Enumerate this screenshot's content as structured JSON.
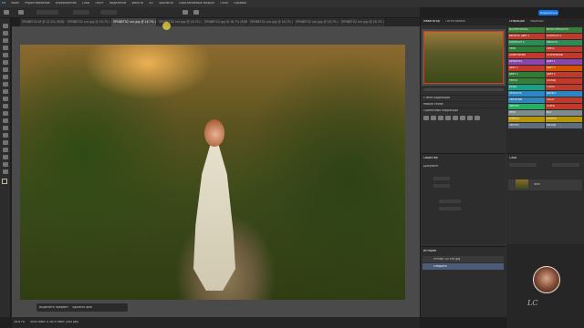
{
  "menu": [
    "Файл",
    "Редактирование",
    "Изображение",
    "Слои",
    "Текст",
    "Выделение",
    "Фильтр",
    "3D",
    "Просмотр",
    "Подключаемые модули",
    "Окно",
    "Справка"
  ],
  "options": {
    "share_label": "Поделиться"
  },
  "tabs": [
    {
      "label": "ПРИВЕТ02.tif @ 12.5% (RGB/8)"
    },
    {
      "label": "ПРИВЕТ02 сат.jpg @ 16.7% (RGB/8)"
    },
    {
      "label": "ПРИВЕТ02 сат.jpg @ 16.7% (RGB/8)"
    },
    {
      "label": "ПРИВЕТ02 сат.jpg @ 16.7% (RGB/8)"
    },
    {
      "label": "ПРИВЕТ02.jpg @ 16.7% (RGB/8)"
    },
    {
      "label": "ПРИВЕТ02 сат.jpg @ 16.7% (RGB/8)"
    },
    {
      "label": "ПРИВЕТ02 сат.jpg @ 16.7% (RGB/8)"
    },
    {
      "label": "ПРИВЕТ02 сат.jpg @ 16.7% (RGB/8)"
    }
  ],
  "status": {
    "zoom": "16.67%",
    "info": "4000 пикс x 2670 пикс (300 ppi)"
  },
  "navigator": {
    "tab1": "Навигатор",
    "tab2": "Гистограмма"
  },
  "adjust": {
    "row1": "Стили коррекции",
    "row2": "Новые стили",
    "row3": "Одиночные коррекции"
  },
  "props": {
    "title": "Свойства",
    "subtitle": "Документ"
  },
  "layers": {
    "title": "Слои",
    "layer_name": "Фон"
  },
  "history": {
    "title": "История",
    "item1": "ПРИВЕТ02 сат.jpg",
    "item2": "Открыть"
  },
  "swatches": {
    "title1": "Операции",
    "title2": "Образцы",
    "items": [
      "МАСТЕР КРОПА",
      "МЕНЮ РЕЗКОСТИ",
      "ВЕРНУТЬ ЦВЕТ 1",
      "КОНТРАСТ 1",
      "КОНТРАСТ 2",
      "ЯРКОСТЬ",
      "ТЕНИ",
      "СВЕТА",
      "ОСВЕТЛЕНИЕ",
      "ЗАТЕМНЕНИЕ",
      "ВИНЬЕТКА",
      "ЦВЕТ 1",
      "ЦВЕТ 2",
      "ЦВЕТ 3",
      "ЦВЕТ 4",
      "ЦВЕТ 5",
      "ТЕПЛО",
      "ХОЛОД",
      "КОЖА",
      "ГЛАЗА",
      "РЕЗКОСТЬ",
      "ДЫМКА",
      "СВЕЧЕНИЕ",
      "ЗАКАТ",
      "ЗЕЛЕНЬ",
      "ОСЕНЬ",
      "ЛЕТО",
      "МАТ",
      "ПЛЁНКА",
      "КОНТУР",
      "ЧИСТКА",
      "ВЫХОД"
    ],
    "colors": [
      "#3a7d3a",
      "#3a7d3a",
      "#c0392b",
      "#c0392b",
      "#2e8b57",
      "#2e8b57",
      "#2e7d32",
      "#c0392b",
      "#c0392b",
      "#c0392b",
      "#8e44ad",
      "#8e44ad",
      "#c0392b",
      "#d35400",
      "#2e7d32",
      "#c0392b",
      "#3a7d3a",
      "#c0392b",
      "#16a085",
      "#c0392b",
      "#2e86c1",
      "#2e86c1",
      "#2e86c1",
      "#c0392b",
      "#27ae60",
      "#c0392b",
      "#7f8c8d",
      "#7f8c8d",
      "#b7950b",
      "#b7950b",
      "#5d6d7e",
      "#5d6d7e"
    ]
  },
  "watermark": {
    "text": "LC"
  },
  "canvas_bottom": {
    "btn1": "Выделить предмет",
    "btn2": "Удалить фон"
  }
}
